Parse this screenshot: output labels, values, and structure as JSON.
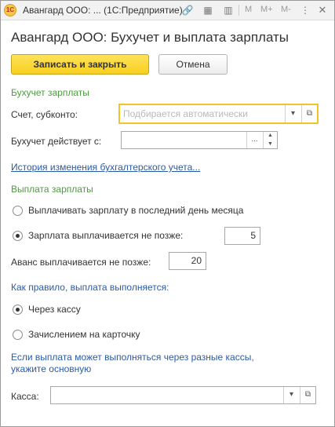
{
  "window": {
    "app_logo": "1С",
    "title": "Авангард ООО: ...   (1С:Предприятие)",
    "toolbar": {
      "m": "M",
      "m_plus": "M+",
      "m_minus": "M-"
    }
  },
  "form": {
    "title": "Авангард ООО: Бухучет и выплата зарплаты",
    "save_close_label": "Записать и закрыть",
    "cancel_label": "Отмена"
  },
  "accounting": {
    "section": "Бухучет зарплаты",
    "account_label": "Счет, субконто:",
    "account_placeholder": "Подбирается автоматически",
    "effective_label": "Бухучет действует с:",
    "effective_value": "",
    "history_link": "История изменения бухгалтерского учета..."
  },
  "payment": {
    "section": "Выплата зарплаты",
    "option_last_day": "Выплачивать зарплату в последний день месяца",
    "option_not_later": "Зарплата выплачивается не позже:",
    "not_later_value": "5",
    "advance_label": "Аванс выплачивается не позже:",
    "advance_value": "20",
    "method_question": "Как правило, выплата выполняется:",
    "method_cash": "Через кассу",
    "method_card": "Зачислением на карточку",
    "note_line1": "Если выплата может выполняться через разные кассы,",
    "note_line2": "укажите основную",
    "cash_label": "Касса:",
    "cash_value": ""
  },
  "icons": {
    "dropdown": "▾",
    "open": "⧉",
    "ellipsis": "...",
    "spin_up": "▲",
    "spin_down": "▼"
  },
  "colors": {
    "section": "#4a9d3a",
    "link": "#2a5aa7",
    "primary_button": "#f7cf1e",
    "focus_border": "#f2c42a"
  }
}
